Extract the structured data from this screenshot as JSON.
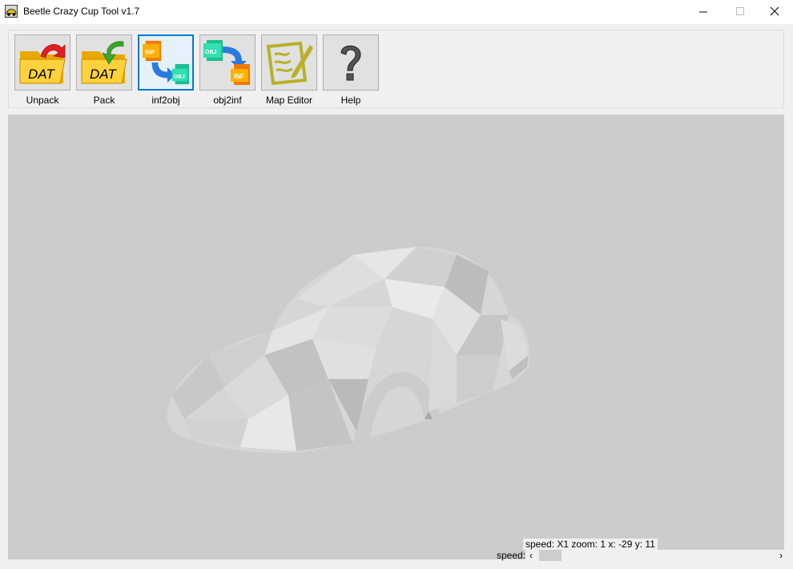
{
  "window": {
    "title": "Beetle Crazy Cup Tool v1.7"
  },
  "toolbar": {
    "buttons": [
      {
        "label": "Unpack",
        "icon": "dat-unpack-icon"
      },
      {
        "label": "Pack",
        "icon": "dat-pack-icon"
      },
      {
        "label": "inf2obj",
        "icon": "inf2obj-icon",
        "active": true
      },
      {
        "label": "obj2inf",
        "icon": "obj2inf-icon"
      },
      {
        "label": "Map Editor",
        "icon": "map-editor-icon"
      },
      {
        "label": "Help",
        "icon": "help-icon"
      }
    ]
  },
  "status": {
    "text": "speed: X1 zoom: 1 x: -29 y: 11",
    "speed_label": "speed:"
  },
  "colors": {
    "viewport": "#cccccc",
    "accent": "#0078d7"
  }
}
